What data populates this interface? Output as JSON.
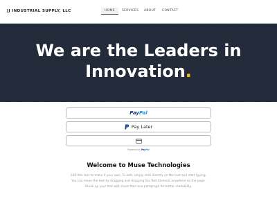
{
  "header": {
    "brand": "JJ INDUSTRIAL SUPPLY, LLC",
    "nav": [
      {
        "label": "HOME",
        "active": true
      },
      {
        "label": "SERVICES",
        "active": false
      },
      {
        "label": "ABOUT",
        "active": false
      },
      {
        "label": "CONTACT",
        "active": false
      }
    ]
  },
  "hero": {
    "line1": "We are the Leaders  in",
    "line2": "Innovation",
    "accent": ".",
    "accent_color": "#f2c200",
    "background_color": "#232a39"
  },
  "payment": {
    "paypal_part1": "Pay",
    "paypal_part2": "Pal",
    "paylater_label": "Pay Later",
    "card_icon": "credit-card-icon",
    "powered_by": "Powered by",
    "powered_part1": "Pay",
    "powered_part2": "Pal"
  },
  "content": {
    "heading": "Welcome to Muse Technologies",
    "lines": [
      "Edit this text to make it your own. To edit, simply click directly on the text and start typing.",
      "You can move the text by dragging and dropping the Text Element anywhere on the page.",
      "Break up your text with more than one paragraph for better readability."
    ]
  }
}
